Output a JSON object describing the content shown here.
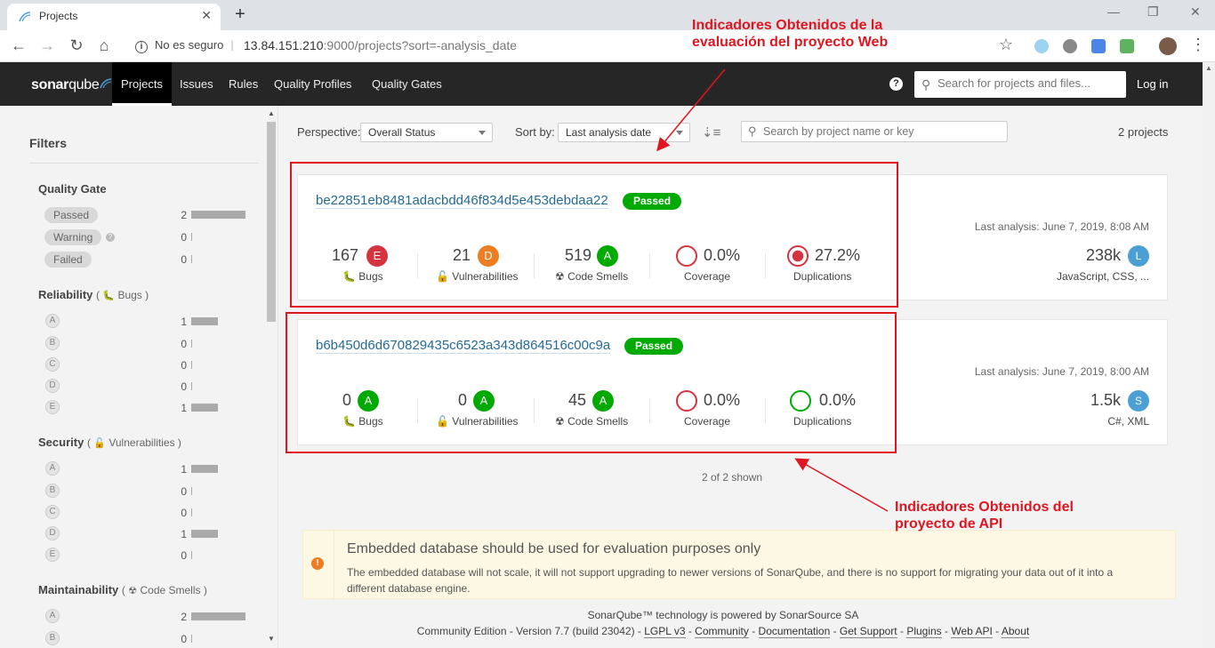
{
  "browser": {
    "tab_title": "Projects",
    "tab_close": "✕",
    "new_tab": "+",
    "security_label": "No es seguro",
    "url_host": "13.84.151.210",
    "url_rest": ":9000/projects?sort=-analysis_date"
  },
  "nav": {
    "logo_sonar": "sonar",
    "logo_qube": "qube",
    "items": [
      "Projects",
      "Issues",
      "Rules",
      "Quality Profiles",
      "Quality Gates"
    ],
    "help": "?",
    "search_placeholder": "Search for projects and files...",
    "login": "Log in"
  },
  "sidebar": {
    "title": "Filters",
    "quality_gate": {
      "title": "Quality Gate",
      "items": [
        {
          "label": "Passed",
          "count": "2"
        },
        {
          "label": "Warning",
          "count": "0"
        },
        {
          "label": "Failed",
          "count": "0"
        }
      ]
    },
    "reliability": {
      "title": "Reliability",
      "sub": "Bugs",
      "items": [
        {
          "label": "A",
          "count": "1"
        },
        {
          "label": "B",
          "count": "0"
        },
        {
          "label": "C",
          "count": "0"
        },
        {
          "label": "D",
          "count": "0"
        },
        {
          "label": "E",
          "count": "1"
        }
      ]
    },
    "security": {
      "title": "Security",
      "sub": "Vulnerabilities",
      "items": [
        {
          "label": "A",
          "count": "1"
        },
        {
          "label": "B",
          "count": "0"
        },
        {
          "label": "C",
          "count": "0"
        },
        {
          "label": "D",
          "count": "1"
        },
        {
          "label": "E",
          "count": "0"
        }
      ]
    },
    "maintainability": {
      "title": "Maintainability",
      "sub": "Code Smells",
      "items": [
        {
          "label": "A",
          "count": "2"
        },
        {
          "label": "B",
          "count": "0"
        }
      ]
    }
  },
  "toolbar": {
    "perspective_label": "Perspective:",
    "perspective_value": "Overall Status",
    "sort_label": "Sort by:",
    "sort_value": "Last analysis date",
    "search_placeholder": "Search by project name or key",
    "project_count": "2 projects"
  },
  "metric_labels": {
    "bugs": "Bugs",
    "vulnerabilities": "Vulnerabilities",
    "code_smells": "Code Smells",
    "coverage": "Coverage",
    "duplications": "Duplications"
  },
  "projects": [
    {
      "name": "be22851eb8481adacbdd46f834d5e453debdaa22",
      "gate": "Passed",
      "last_analysis": "Last analysis: June 7, 2019, 8:08 AM",
      "bugs": "167",
      "bugs_rating": "E",
      "vulnerabilities": "21",
      "vulnerabilities_rating": "D",
      "code_smells": "519",
      "code_smells_rating": "A",
      "coverage": "0.0%",
      "duplications": "27.2%",
      "size": "238k",
      "size_badge": "L",
      "languages": "JavaScript, CSS, ..."
    },
    {
      "name": "b6b450d6d670829435c6523a343d864516c00c9a",
      "gate": "Passed",
      "last_analysis": "Last analysis: June 7, 2019, 8:00 AM",
      "bugs": "0",
      "bugs_rating": "A",
      "vulnerabilities": "0",
      "vulnerabilities_rating": "A",
      "code_smells": "45",
      "code_smells_rating": "A",
      "coverage": "0.0%",
      "duplications": "0.0%",
      "size": "1.5k",
      "size_badge": "S",
      "languages": "C#, XML"
    }
  ],
  "shown": "2 of 2 shown",
  "warning": {
    "title": "Embedded database should be used for evaluation purposes only",
    "text": "The embedded database will not scale, it will not support upgrading to newer versions of SonarQube, and there is no support for migrating your data out of it into a different database engine."
  },
  "footer": {
    "line1": "SonarQube™ technology is powered by SonarSource SA",
    "edition": "Community Edition - Version 7.7 (build 23042) -",
    "links": [
      "LGPL v3",
      "Community",
      "Documentation",
      "Get Support",
      "Plugins",
      "Web API",
      "About"
    ]
  },
  "annotations": {
    "top": [
      "Indicadores Obtenidos de la",
      "evaluación del proyecto Web"
    ],
    "bottom": [
      "Indicadores Obtenidos del",
      "proyecto de API"
    ]
  },
  "colors": {
    "rating_A": "#00aa00",
    "rating_D": "#ed7d20",
    "rating_E": "#d4333f",
    "annotation": "#e0151f",
    "passed": "#00aa00",
    "nav_bg": "#262626"
  }
}
